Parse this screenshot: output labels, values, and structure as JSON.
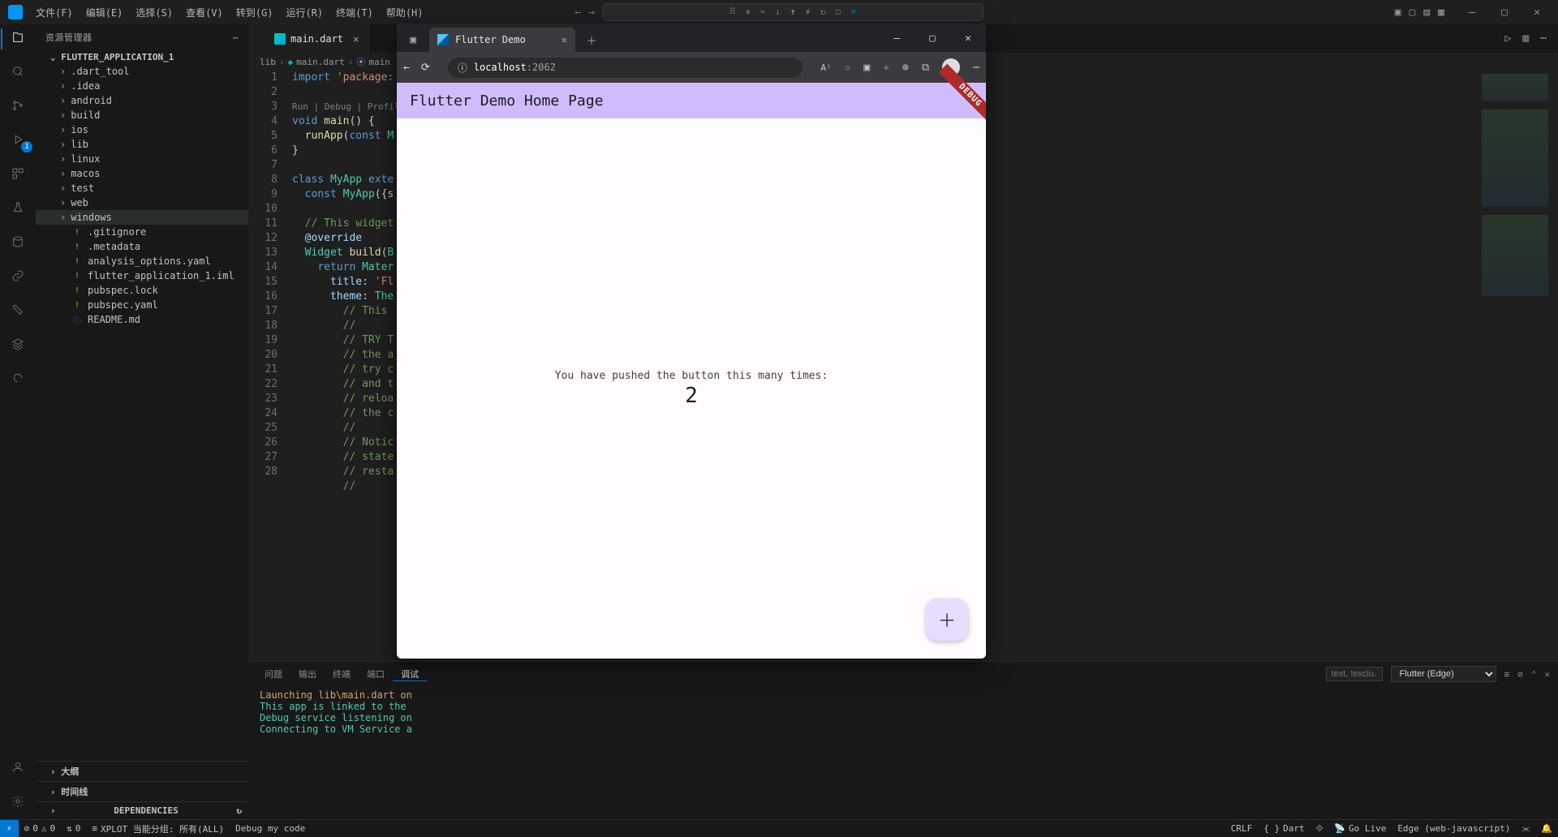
{
  "menubar": {
    "items": [
      "文件(F)",
      "编辑(E)",
      "选择(S)",
      "查看(V)",
      "转到(G)",
      "运行(R)",
      "终端(T)",
      "帮助(H)"
    ]
  },
  "debugToolbar": [
    "⠿",
    "⏸",
    "↷",
    "↓",
    "↑",
    "⚡",
    "↻",
    "◻",
    "⌕"
  ],
  "layoutIcons": [
    "▣",
    "▢",
    "▤",
    "▦"
  ],
  "explorer": {
    "title": "资源管理器",
    "project": "FLUTTER_APPLICATION_1",
    "tree": [
      {
        "t": "folder",
        "l": ".dart_tool"
      },
      {
        "t": "folder",
        "l": ".idea"
      },
      {
        "t": "folder",
        "l": "android"
      },
      {
        "t": "folder",
        "l": "build"
      },
      {
        "t": "folder",
        "l": "ios"
      },
      {
        "t": "folder",
        "l": "lib"
      },
      {
        "t": "folder",
        "l": "linux"
      },
      {
        "t": "folder",
        "l": "macos"
      },
      {
        "t": "folder",
        "l": "test"
      },
      {
        "t": "folder",
        "l": "web"
      },
      {
        "t": "folder",
        "l": "windows",
        "sel": true
      },
      {
        "t": "file",
        "l": ".gitignore",
        "i": "ex"
      },
      {
        "t": "file",
        "l": ".metadata",
        "i": "ex"
      },
      {
        "t": "file",
        "l": "analysis_options.yaml",
        "i": "ex"
      },
      {
        "t": "file",
        "l": "flutter_application_1.iml",
        "i": "ex"
      },
      {
        "t": "file",
        "l": "pubspec.lock",
        "i": "ex"
      },
      {
        "t": "file",
        "l": "pubspec.yaml",
        "i": "ex"
      },
      {
        "t": "file",
        "l": "README.md",
        "i": "info"
      }
    ],
    "sections": [
      "大纲",
      "时间线",
      "DEPENDENCIES"
    ]
  },
  "editor": {
    "tab": "main.dart",
    "breadcrumb": [
      "lib",
      "main.dart",
      "main"
    ],
    "codelens": "Run | Debug | Profile",
    "code": [
      {
        "n": 1,
        "h": "<span class='k'>import</span> <span class='s'>'package:</span>"
      },
      {
        "n": 2,
        "h": ""
      },
      {
        "n": "",
        "h": "<span class='codelens'>Run | Debug | Profile</span>"
      },
      {
        "n": 3,
        "h": "<span class='k'>void</span> <span class='f'>main</span>() {"
      },
      {
        "n": 4,
        "h": "  <span class='f'>runApp</span>(<span class='k'>const</span> <span class='t'>M</span>"
      },
      {
        "n": 5,
        "h": "}"
      },
      {
        "n": 6,
        "h": ""
      },
      {
        "n": 7,
        "h": "<span class='k'>class</span> <span class='t'>MyApp</span> <span class='k'>exte</span>"
      },
      {
        "n": 8,
        "h": "  <span class='k'>const</span> <span class='t'>MyApp</span>({<span class='p'>s</span>"
      },
      {
        "n": 9,
        "h": ""
      },
      {
        "n": 10,
        "h": "  <span class='c'>// This widget</span>"
      },
      {
        "n": 11,
        "h": "  <span class='d'>@override</span>"
      },
      {
        "n": 12,
        "h": "  <span class='t'>Widget</span> <span class='f'>build</span>(<span class='t'>B</span>"
      },
      {
        "n": 13,
        "h": "    <span class='k'>return</span> <span class='t'>Mater</span>"
      },
      {
        "n": 14,
        "h": "      <span class='p'>title</span>: <span class='s'>'Fl</span>"
      },
      {
        "n": 15,
        "h": "      <span class='p'>theme</span>: <span class='t'>The</span>"
      },
      {
        "n": 16,
        "h": "        <span class='c'>// This </span>"
      },
      {
        "n": 17,
        "h": "        <span class='c'>//</span>"
      },
      {
        "n": 18,
        "h": "        <span class='c'>// TRY T</span>"
      },
      {
        "n": 19,
        "h": "        <span class='c'>// the a</span>"
      },
      {
        "n": 20,
        "h": "        <span class='c'>// try c</span>"
      },
      {
        "n": 21,
        "h": "        <span class='c'>// and t</span>"
      },
      {
        "n": 22,
        "h": "        <span class='c'>// reloa</span>"
      },
      {
        "n": 23,
        "h": "        <span class='c'>// the c</span>"
      },
      {
        "n": 24,
        "h": "        <span class='c'>//</span>"
      },
      {
        "n": 25,
        "h": "        <span class='c'>// Notic</span>"
      },
      {
        "n": 26,
        "h": "        <span class='c'>// state</span>"
      },
      {
        "n": 27,
        "h": "        <span class='c'>// resta</span>"
      },
      {
        "n": 28,
        "h": "        <span class='c'>//</span>"
      }
    ]
  },
  "panel": {
    "tabs": [
      "问题",
      "输出",
      "终端",
      "端口",
      "调试"
    ],
    "activeTab": 4,
    "filter": "text, !exclu...",
    "select": "Flutter (Edge)",
    "output": [
      "Launching lib\\main.dart on",
      "This app is linked to the ",
      "Debug service listening on",
      "Connecting to VM Service a"
    ]
  },
  "status": {
    "left": {
      "err": "0",
      "warn": "0",
      "port": "0",
      "xplot": "XPLOT 当能分组: 所有(ALL)",
      "debug": "Debug my code"
    },
    "right": {
      "crlf": "CRLF",
      "lang": "Dart",
      "golive": "Go Live",
      "target": "Edge (web-javascript)"
    }
  },
  "browser": {
    "tabTitle": "Flutter Demo",
    "host": "localhost",
    "port": ":2062",
    "appTitle": "Flutter Demo Home Page",
    "msg": "You have pushed the button this many times:",
    "count": "2",
    "debug": "DEBUG"
  }
}
